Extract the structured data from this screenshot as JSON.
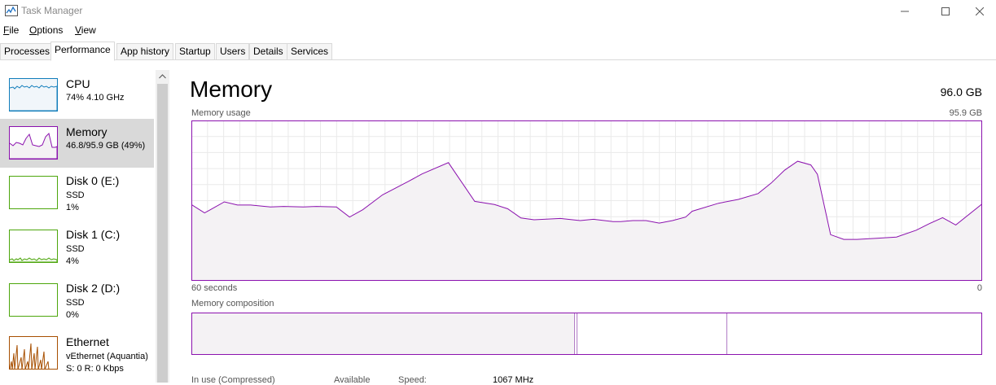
{
  "window": {
    "title": "Task Manager",
    "minimize_glyph": "—",
    "maximize_glyph": "☐",
    "close_glyph": "✕"
  },
  "menu": [
    "File",
    "Options",
    "View"
  ],
  "tabs": [
    {
      "label": "Processes"
    },
    {
      "label": "Performance",
      "active": true
    },
    {
      "label": "App history"
    },
    {
      "label": "Startup"
    },
    {
      "label": "Users"
    },
    {
      "label": "Details"
    },
    {
      "label": "Services"
    }
  ],
  "sidebar": {
    "items": [
      {
        "name": "CPU",
        "line1": "74% 4.10 GHz",
        "line2": "",
        "color": "#117dbb"
      },
      {
        "name": "Memory",
        "line1": "46.8/95.9 GB (49%)",
        "line2": "",
        "color": "#8b12ae"
      },
      {
        "name": "Disk 0 (E:)",
        "line1": "SSD",
        "line2": "1%",
        "color": "#4da60c"
      },
      {
        "name": "Disk 1 (C:)",
        "line1": "SSD",
        "line2": "4%",
        "color": "#4da60c"
      },
      {
        "name": "Disk 2 (D:)",
        "line1": "SSD",
        "line2": "0%",
        "color": "#4da60c"
      },
      {
        "name": "Ethernet",
        "line1": "vEthernet (Aquantia)",
        "line2": "S: 0 R: 0 Kbps",
        "color": "#a74f01"
      }
    ]
  },
  "main": {
    "title": "Memory",
    "total": "96.0 GB",
    "usage_label": "Memory usage",
    "usage_max": "95.9 GB",
    "time_left": "60 seconds",
    "time_right": "0",
    "composition_label": "Memory composition",
    "stats_partial": [
      "In use (Compressed)",
      "Available",
      "Speed:",
      "1067 MHz"
    ]
  },
  "chart_data": {
    "type": "area",
    "title": "Memory usage",
    "xlabel": "",
    "ylabel": "",
    "ylim": [
      0,
      95.9
    ],
    "xlim": [
      60,
      0
    ],
    "x": [
      60,
      59,
      57.5,
      56.5,
      55.5,
      54,
      53,
      51.5,
      50.5,
      49,
      48,
      47,
      45.5,
      43.5,
      42.5,
      40.5,
      38.5,
      37,
      36,
      35,
      34,
      32,
      30.5,
      29.5,
      28,
      27.5,
      26.5,
      25.5,
      24.5,
      23.5,
      22.5,
      22,
      20,
      18.5,
      17,
      16,
      15,
      14,
      13,
      12.5,
      11.5,
      10.5,
      9.5,
      8,
      6.5,
      5,
      4,
      3,
      2,
      0
    ],
    "values": [
      45.6,
      40.6,
      47.2,
      45.3,
      45.3,
      44.2,
      44.5,
      44.2,
      44.5,
      44.2,
      38.1,
      42.5,
      51.4,
      59.6,
      63.9,
      70.7,
      47.5,
      45.6,
      43.1,
      37.6,
      36.5,
      37.3,
      36.0,
      36.8,
      35.4,
      35.4,
      36.0,
      36.0,
      34.5,
      36.0,
      38.1,
      41.6,
      46.4,
      48.7,
      52.2,
      58.5,
      66.1,
      71.5,
      69.3,
      63.7,
      27.6,
      24.8,
      24.8,
      25.4,
      26.2,
      30.3,
      34.2,
      37.8,
      33.4,
      46.0
    ],
    "grid": true
  },
  "composition": {
    "in_use_fraction": 0.485,
    "modified_fraction": 0.003,
    "standby_fraction": 0.19
  },
  "colors": {
    "memory": "#8b12ae",
    "memory_fill": "#f4f2f4",
    "grid": "#eaeaea",
    "selected": "#d9d9d9"
  }
}
